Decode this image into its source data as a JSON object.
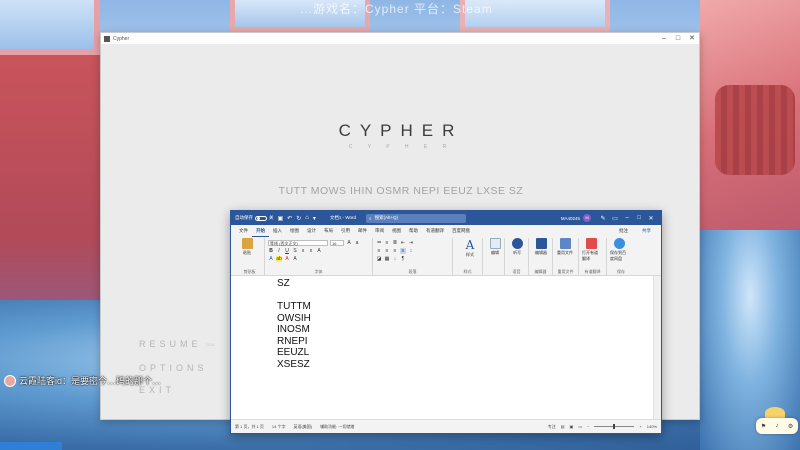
{
  "stream": {
    "caption": "…游戏名：Cypher  平台：Steam",
    "chat_message": "云霞陆客id：是要密今…码的那个…"
  },
  "game": {
    "window_title": "Cypher",
    "logo": "CYPHER",
    "logo_sub": "C Y P H E R",
    "puzzle_text": "TUTT MOWS IHIN OSMR NEPI EEUZ LXSE SZ",
    "menu": {
      "resume": "RESUME",
      "resume_sub": "2018",
      "options": "OPTIONS",
      "exit": "EXIT"
    }
  },
  "word": {
    "title_bar": {
      "autosave_label": "自动保存",
      "autosave_state": "关",
      "doc_name": "文档1 - Word",
      "search_placeholder": "搜索(Alt+Q)",
      "user_name": "MA40245",
      "avatar_initials": "M"
    },
    "tabs": [
      "文件",
      "开始",
      "插入",
      "绘图",
      "设计",
      "布局",
      "引用",
      "邮件",
      "审阅",
      "视图",
      "帮助",
      "有道翻译",
      "百度网盘"
    ],
    "active_tab": "开始",
    "tab_right": {
      "comments": "批注",
      "share": "共享"
    },
    "ribbon": {
      "paste": "粘贴",
      "clipboard": "剪贴板",
      "font_name": "等线 (西文正文)",
      "font_size": "16",
      "font_group": "字体",
      "paragraph_group": "段落",
      "styles": "样式",
      "styles_group": "样式",
      "editing": "编辑",
      "dictate": "听写",
      "voice_group": "语音",
      "editor": "编辑器",
      "editor_group": "编辑器",
      "reuse": "重用文件",
      "reuse_group": "重用文件",
      "translate": "打开有道翻译",
      "translate_group": "有道翻译",
      "save_baidu": "保存到百度网盘",
      "save_group": "保存"
    },
    "document_lines": [
      "SZ",
      "",
      "TUTTM",
      "OWSIH",
      "INOSM",
      "RNEPI",
      "EEUZL",
      "XSESZ"
    ],
    "status": {
      "page": "第 1 页，共 1 页",
      "words": "14 个字",
      "language": "英语(美国)",
      "accessibility": "辅助功能: 一切就绪",
      "focus": "专注",
      "zoom": "140%"
    }
  }
}
